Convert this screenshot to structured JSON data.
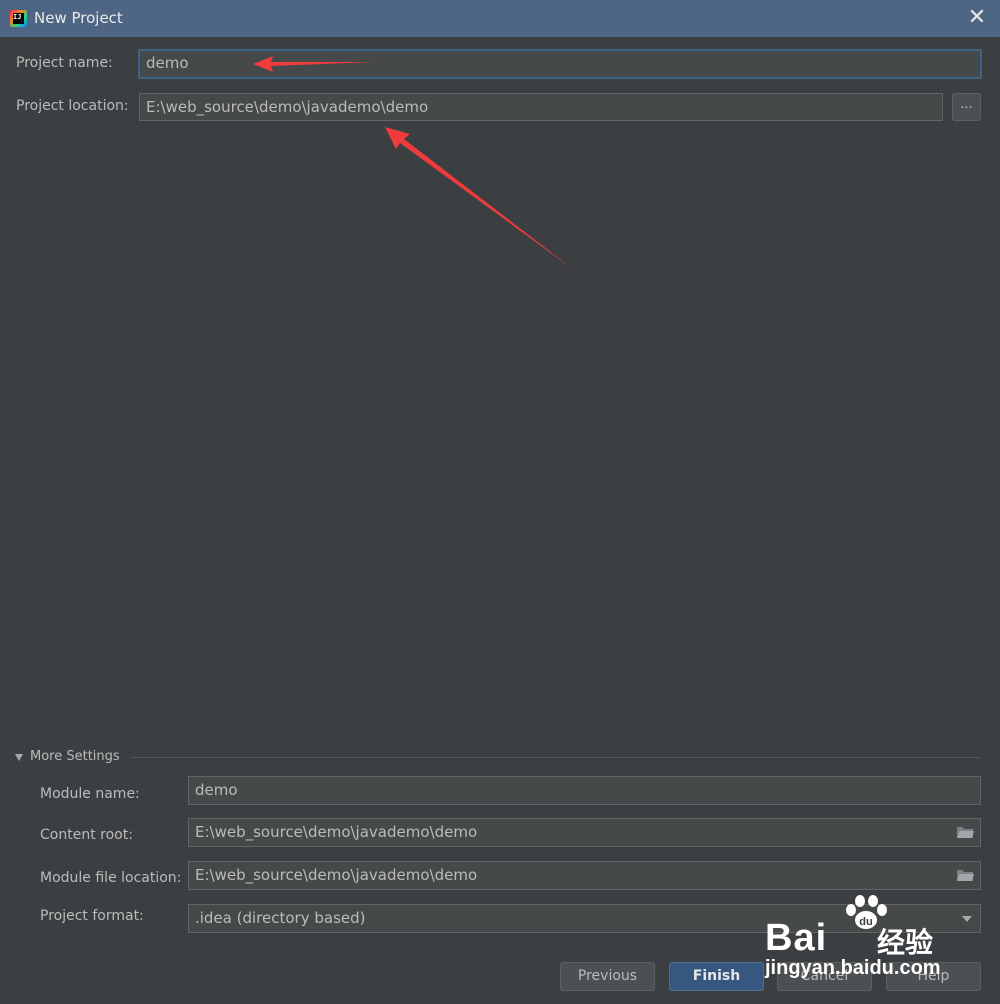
{
  "window": {
    "title": "New Project",
    "app_icon_text": "IJ",
    "app_icon": "intellij-idea-icon",
    "close_icon": "close-icon"
  },
  "project": {
    "name_label": "Project name:",
    "name_value": "demo",
    "location_label": "Project location:",
    "location_value": "E:\\web_source\\demo\\javademo\\demo",
    "browse_label": "..."
  },
  "more_settings": {
    "title": "More Settings",
    "expanded": true,
    "module_name_label": "Module name:",
    "module_name_value": "demo",
    "content_root_label": "Content root:",
    "content_root_value": "E:\\web_source\\demo\\javademo\\demo",
    "module_file_location_label": "Module file location:",
    "module_file_location_value": "E:\\web_source\\demo\\javademo\\demo",
    "project_format_label": "Project format:",
    "project_format_value": ".idea (directory based)"
  },
  "buttons": {
    "previous": "Previous",
    "finish": "Finish",
    "cancel": "Cancel",
    "help": "Help"
  },
  "watermark": {
    "brand": "Bai",
    "brand_cn": "经验",
    "url": "jingyan.baidu.com"
  },
  "colors": {
    "background": "#3c3f41",
    "titlebar": "#4e6684",
    "field": "#45494a",
    "primary_button": "#365880",
    "annotation_arrow": "#ef3b3b"
  }
}
